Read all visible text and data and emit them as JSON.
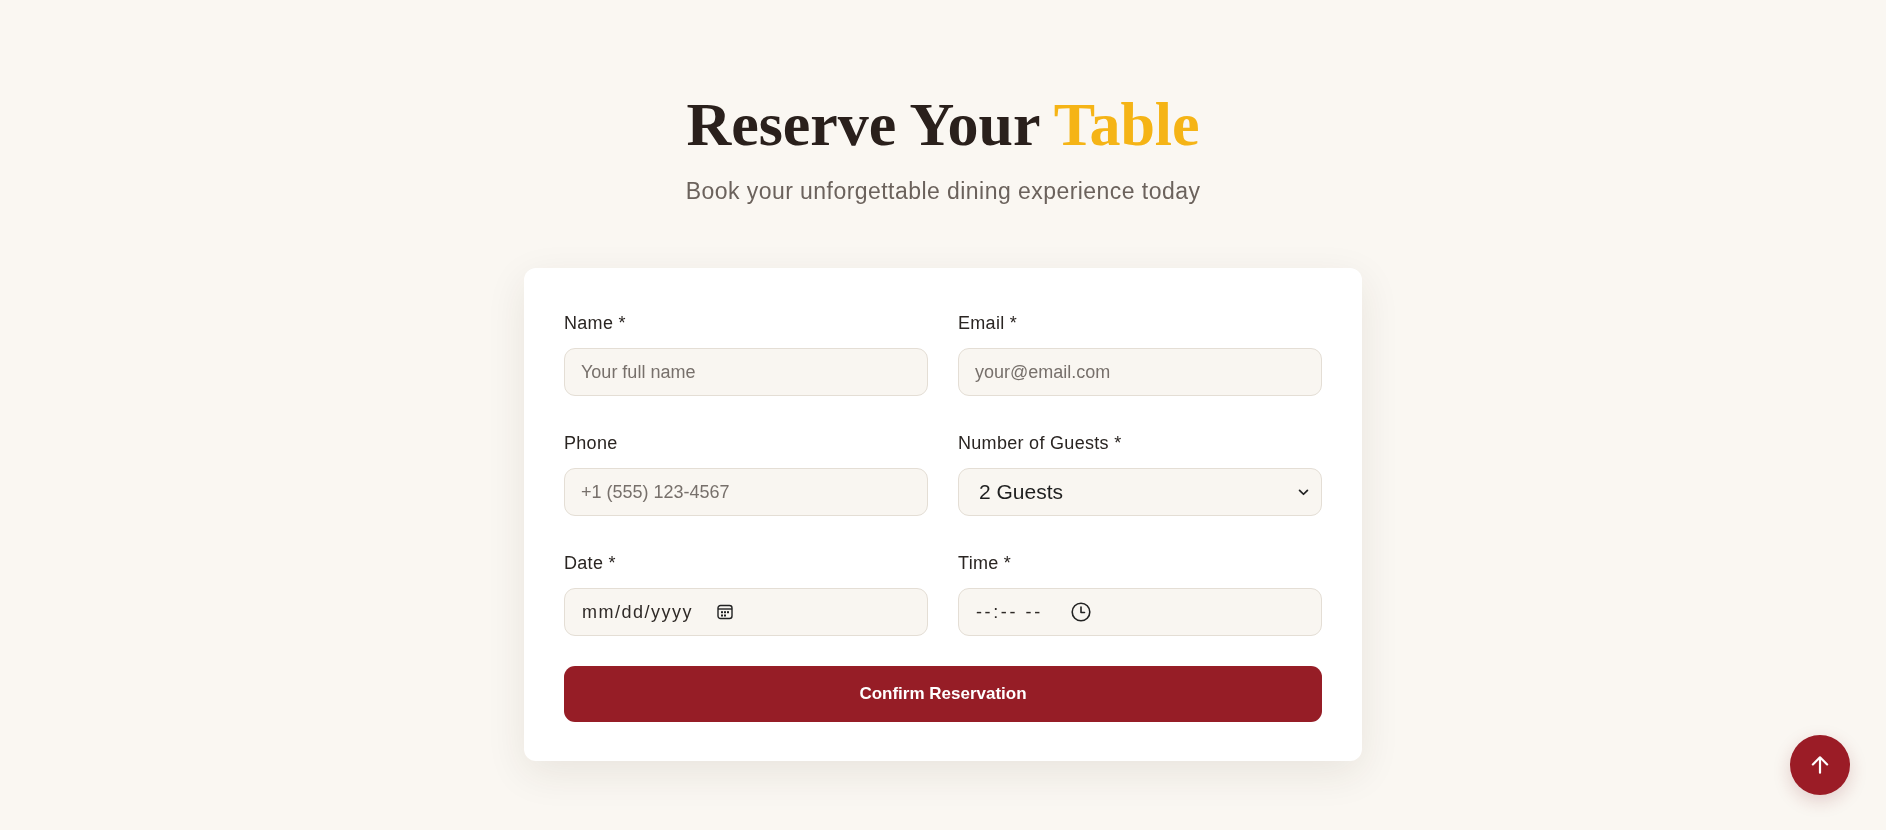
{
  "header": {
    "title": "Reserve Your",
    "title_highlight": "Table",
    "subtitle": "Book your unforgettable dining experience today"
  },
  "form": {
    "fields": [
      {
        "kind": "text",
        "label": "Name *",
        "placeholder": "Your full name"
      },
      {
        "kind": "text",
        "label": "Email *",
        "placeholder": "your@email.com"
      },
      {
        "kind": "text",
        "label": "Phone",
        "placeholder": "+1 (555) 123-4567"
      },
      {
        "kind": "select",
        "label": "Number of Guests *",
        "value": "2 Guests"
      },
      {
        "kind": "date",
        "label": "Date *",
        "placeholder": "mm/dd/yyyy"
      },
      {
        "kind": "time",
        "label": "Time *",
        "placeholder": "--:-- --"
      }
    ],
    "submit": "Confirm Reservation"
  }
}
